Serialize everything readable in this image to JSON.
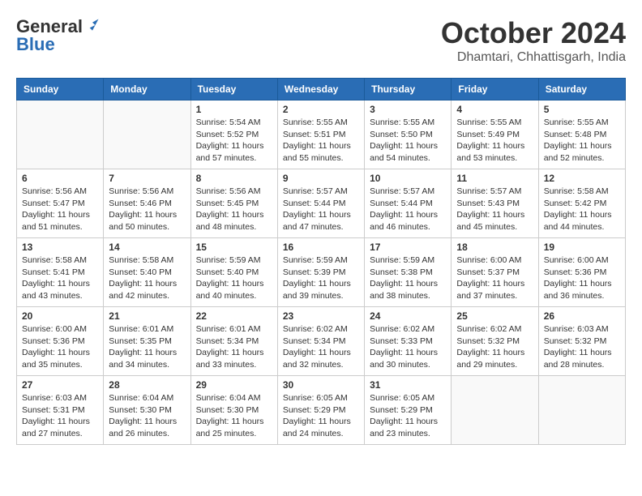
{
  "logo": {
    "general": "General",
    "blue": "Blue"
  },
  "header": {
    "month": "October 2024",
    "location": "Dhamtari, Chhattisgarh, India"
  },
  "weekdays": [
    "Sunday",
    "Monday",
    "Tuesday",
    "Wednesday",
    "Thursday",
    "Friday",
    "Saturday"
  ],
  "weeks": [
    [
      {
        "day": null,
        "info": null
      },
      {
        "day": null,
        "info": null
      },
      {
        "day": "1",
        "info": "Sunrise: 5:54 AM\nSunset: 5:52 PM\nDaylight: 11 hours and 57 minutes."
      },
      {
        "day": "2",
        "info": "Sunrise: 5:55 AM\nSunset: 5:51 PM\nDaylight: 11 hours and 55 minutes."
      },
      {
        "day": "3",
        "info": "Sunrise: 5:55 AM\nSunset: 5:50 PM\nDaylight: 11 hours and 54 minutes."
      },
      {
        "day": "4",
        "info": "Sunrise: 5:55 AM\nSunset: 5:49 PM\nDaylight: 11 hours and 53 minutes."
      },
      {
        "day": "5",
        "info": "Sunrise: 5:55 AM\nSunset: 5:48 PM\nDaylight: 11 hours and 52 minutes."
      }
    ],
    [
      {
        "day": "6",
        "info": "Sunrise: 5:56 AM\nSunset: 5:47 PM\nDaylight: 11 hours and 51 minutes."
      },
      {
        "day": "7",
        "info": "Sunrise: 5:56 AM\nSunset: 5:46 PM\nDaylight: 11 hours and 50 minutes."
      },
      {
        "day": "8",
        "info": "Sunrise: 5:56 AM\nSunset: 5:45 PM\nDaylight: 11 hours and 48 minutes."
      },
      {
        "day": "9",
        "info": "Sunrise: 5:57 AM\nSunset: 5:44 PM\nDaylight: 11 hours and 47 minutes."
      },
      {
        "day": "10",
        "info": "Sunrise: 5:57 AM\nSunset: 5:44 PM\nDaylight: 11 hours and 46 minutes."
      },
      {
        "day": "11",
        "info": "Sunrise: 5:57 AM\nSunset: 5:43 PM\nDaylight: 11 hours and 45 minutes."
      },
      {
        "day": "12",
        "info": "Sunrise: 5:58 AM\nSunset: 5:42 PM\nDaylight: 11 hours and 44 minutes."
      }
    ],
    [
      {
        "day": "13",
        "info": "Sunrise: 5:58 AM\nSunset: 5:41 PM\nDaylight: 11 hours and 43 minutes."
      },
      {
        "day": "14",
        "info": "Sunrise: 5:58 AM\nSunset: 5:40 PM\nDaylight: 11 hours and 42 minutes."
      },
      {
        "day": "15",
        "info": "Sunrise: 5:59 AM\nSunset: 5:40 PM\nDaylight: 11 hours and 40 minutes."
      },
      {
        "day": "16",
        "info": "Sunrise: 5:59 AM\nSunset: 5:39 PM\nDaylight: 11 hours and 39 minutes."
      },
      {
        "day": "17",
        "info": "Sunrise: 5:59 AM\nSunset: 5:38 PM\nDaylight: 11 hours and 38 minutes."
      },
      {
        "day": "18",
        "info": "Sunrise: 6:00 AM\nSunset: 5:37 PM\nDaylight: 11 hours and 37 minutes."
      },
      {
        "day": "19",
        "info": "Sunrise: 6:00 AM\nSunset: 5:36 PM\nDaylight: 11 hours and 36 minutes."
      }
    ],
    [
      {
        "day": "20",
        "info": "Sunrise: 6:00 AM\nSunset: 5:36 PM\nDaylight: 11 hours and 35 minutes."
      },
      {
        "day": "21",
        "info": "Sunrise: 6:01 AM\nSunset: 5:35 PM\nDaylight: 11 hours and 34 minutes."
      },
      {
        "day": "22",
        "info": "Sunrise: 6:01 AM\nSunset: 5:34 PM\nDaylight: 11 hours and 33 minutes."
      },
      {
        "day": "23",
        "info": "Sunrise: 6:02 AM\nSunset: 5:34 PM\nDaylight: 11 hours and 32 minutes."
      },
      {
        "day": "24",
        "info": "Sunrise: 6:02 AM\nSunset: 5:33 PM\nDaylight: 11 hours and 30 minutes."
      },
      {
        "day": "25",
        "info": "Sunrise: 6:02 AM\nSunset: 5:32 PM\nDaylight: 11 hours and 29 minutes."
      },
      {
        "day": "26",
        "info": "Sunrise: 6:03 AM\nSunset: 5:32 PM\nDaylight: 11 hours and 28 minutes."
      }
    ],
    [
      {
        "day": "27",
        "info": "Sunrise: 6:03 AM\nSunset: 5:31 PM\nDaylight: 11 hours and 27 minutes."
      },
      {
        "day": "28",
        "info": "Sunrise: 6:04 AM\nSunset: 5:30 PM\nDaylight: 11 hours and 26 minutes."
      },
      {
        "day": "29",
        "info": "Sunrise: 6:04 AM\nSunset: 5:30 PM\nDaylight: 11 hours and 25 minutes."
      },
      {
        "day": "30",
        "info": "Sunrise: 6:05 AM\nSunset: 5:29 PM\nDaylight: 11 hours and 24 minutes."
      },
      {
        "day": "31",
        "info": "Sunrise: 6:05 AM\nSunset: 5:29 PM\nDaylight: 11 hours and 23 minutes."
      },
      {
        "day": null,
        "info": null
      },
      {
        "day": null,
        "info": null
      }
    ]
  ]
}
